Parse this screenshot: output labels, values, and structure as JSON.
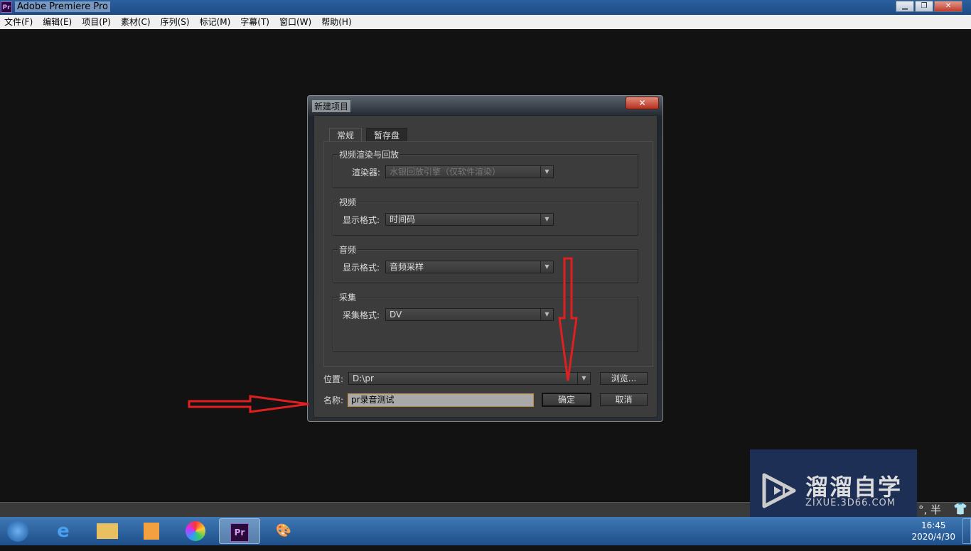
{
  "app": {
    "title": "Adobe Premiere Pro",
    "logo": "Pr"
  },
  "menu": [
    "文件(F)",
    "编辑(E)",
    "项目(P)",
    "素材(C)",
    "序列(S)",
    "标记(M)",
    "字幕(T)",
    "窗口(W)",
    "帮助(H)"
  ],
  "dialog": {
    "title": "新建项目",
    "tabs": [
      "常规",
      "暂存盘"
    ],
    "groups": {
      "render": {
        "title": "视频渲染与回放",
        "label": "渲染器:",
        "value": "水银回放引擎（仅软件渲染）"
      },
      "video": {
        "title": "视频",
        "label": "显示格式:",
        "value": "时间码"
      },
      "audio": {
        "title": "音频",
        "label": "显示格式:",
        "value": "音频采样"
      },
      "capture": {
        "title": "采集",
        "label": "采集格式:",
        "value": "DV"
      }
    },
    "location_label": "位置:",
    "location_value": "D:\\pr",
    "browse": "浏览...",
    "name_label": "名称:",
    "name_value": "pr录音测试",
    "ok": "确定",
    "cancel": "取消"
  },
  "watermark": {
    "title": "溜溜自学",
    "url": "ZIXUE.3D66.COM"
  },
  "tray": {
    "ime": "°, 半",
    "time": "16:45",
    "date": "2020/4/30"
  },
  "colors": {
    "annotation_arrow": "#e02020"
  }
}
